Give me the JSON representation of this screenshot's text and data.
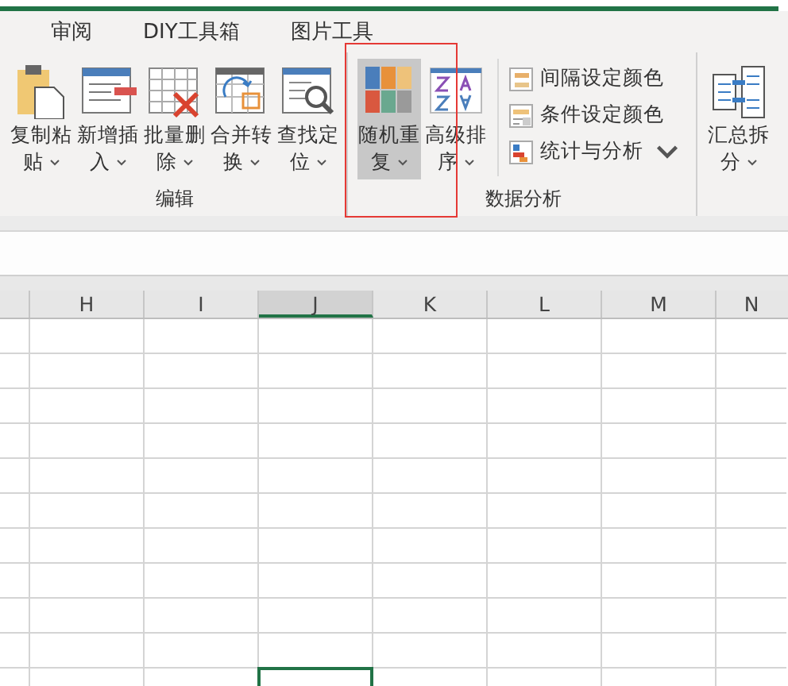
{
  "tabs": [
    {
      "label": "审阅",
      "selected": false
    },
    {
      "label": "DIY工具箱",
      "selected": false
    },
    {
      "label": "图片工具",
      "selected": false
    }
  ],
  "ribbon_groups": [
    {
      "label": "编辑",
      "items": [
        {
          "kind": "large",
          "label": "复制粘贴",
          "dropdown": true,
          "pressed": false
        },
        {
          "kind": "large",
          "label": "新增插入",
          "dropdown": true,
          "pressed": false
        },
        {
          "kind": "large",
          "label": "批量删除",
          "dropdown": true,
          "pressed": false
        },
        {
          "kind": "large",
          "label": "合并转换",
          "dropdown": true,
          "pressed": false
        },
        {
          "kind": "large",
          "label": "查找定位",
          "dropdown": true,
          "pressed": false
        }
      ]
    },
    {
      "label": "数据分析",
      "items": [
        {
          "kind": "large",
          "label": "随机重复",
          "dropdown": true,
          "pressed": true,
          "highlighted": true
        },
        {
          "kind": "large",
          "label": "高级排序",
          "dropdown": true,
          "pressed": false
        },
        {
          "kind": "small",
          "label": "间隔设定颜色",
          "dropdown": false
        },
        {
          "kind": "small",
          "label": "条件设定颜色",
          "dropdown": false
        },
        {
          "kind": "small",
          "label": "统计与分析",
          "dropdown": true
        }
      ]
    },
    {
      "items": [
        {
          "kind": "large",
          "label": "汇总拆分",
          "dropdown": true,
          "pressed": false
        }
      ]
    }
  ],
  "columns": [
    {
      "label": "H",
      "selected": false
    },
    {
      "label": "I",
      "selected": false
    },
    {
      "label": "J",
      "selected": true
    },
    {
      "label": "K",
      "selected": false
    },
    {
      "label": "L",
      "selected": false
    },
    {
      "label": "M",
      "selected": false
    },
    {
      "label": "N",
      "selected": false
    }
  ]
}
